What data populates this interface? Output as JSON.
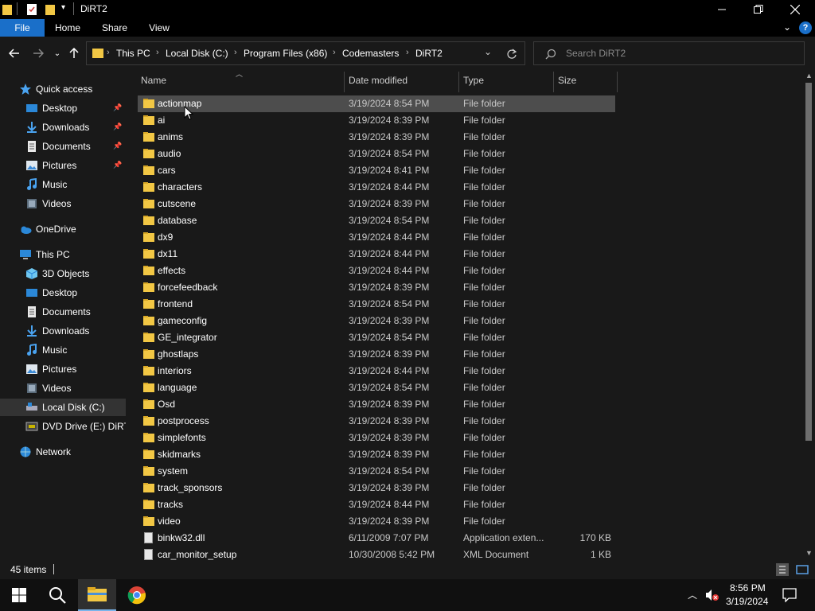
{
  "window": {
    "title": "DiRT2"
  },
  "ribbon": {
    "tabs": [
      "File",
      "Home",
      "Share",
      "View"
    ]
  },
  "address": {
    "crumbs": [
      "This PC",
      "Local Disk (C:)",
      "Program Files (x86)",
      "Codemasters",
      "DiRT2"
    ]
  },
  "search": {
    "placeholder": "Search DiRT2"
  },
  "sidebar": {
    "items": [
      {
        "label": "Quick access",
        "icon": "star-icon"
      },
      {
        "label": "Desktop",
        "icon": "desktop-icon",
        "pinned": true
      },
      {
        "label": "Downloads",
        "icon": "download-icon",
        "pinned": true
      },
      {
        "label": "Documents",
        "icon": "documents-icon",
        "pinned": true
      },
      {
        "label": "Pictures",
        "icon": "pictures-icon",
        "pinned": true
      },
      {
        "label": "Music",
        "icon": "music-icon"
      },
      {
        "label": "Videos",
        "icon": "videos-icon"
      },
      {
        "label": "OneDrive",
        "icon": "cloud-icon"
      },
      {
        "label": "This PC",
        "icon": "computer-icon"
      },
      {
        "label": "3D Objects",
        "icon": "cube-icon"
      },
      {
        "label": "Desktop",
        "icon": "desktop-icon"
      },
      {
        "label": "Documents",
        "icon": "documents-icon"
      },
      {
        "label": "Downloads",
        "icon": "download-icon"
      },
      {
        "label": "Music",
        "icon": "music-icon"
      },
      {
        "label": "Pictures",
        "icon": "pictures-icon"
      },
      {
        "label": "Videos",
        "icon": "videos-icon"
      },
      {
        "label": "Local Disk (C:)",
        "icon": "drive-icon",
        "selected": true
      },
      {
        "label": "DVD Drive (E:) DiRT2",
        "icon": "dvd-icon"
      },
      {
        "label": "Network",
        "icon": "network-icon"
      }
    ]
  },
  "columns": {
    "name": "Name",
    "date": "Date modified",
    "type": "Type",
    "size": "Size"
  },
  "files": [
    {
      "name": "actionmap",
      "date": "3/19/2024 8:54 PM",
      "type": "File folder",
      "size": "",
      "kind": "folder",
      "selected": true
    },
    {
      "name": "ai",
      "date": "3/19/2024 8:39 PM",
      "type": "File folder",
      "size": "",
      "kind": "folder"
    },
    {
      "name": "anims",
      "date": "3/19/2024 8:39 PM",
      "type": "File folder",
      "size": "",
      "kind": "folder"
    },
    {
      "name": "audio",
      "date": "3/19/2024 8:54 PM",
      "type": "File folder",
      "size": "",
      "kind": "folder"
    },
    {
      "name": "cars",
      "date": "3/19/2024 8:41 PM",
      "type": "File folder",
      "size": "",
      "kind": "folder"
    },
    {
      "name": "characters",
      "date": "3/19/2024 8:44 PM",
      "type": "File folder",
      "size": "",
      "kind": "folder"
    },
    {
      "name": "cutscene",
      "date": "3/19/2024 8:39 PM",
      "type": "File folder",
      "size": "",
      "kind": "folder"
    },
    {
      "name": "database",
      "date": "3/19/2024 8:54 PM",
      "type": "File folder",
      "size": "",
      "kind": "folder"
    },
    {
      "name": "dx9",
      "date": "3/19/2024 8:44 PM",
      "type": "File folder",
      "size": "",
      "kind": "folder"
    },
    {
      "name": "dx11",
      "date": "3/19/2024 8:44 PM",
      "type": "File folder",
      "size": "",
      "kind": "folder"
    },
    {
      "name": "effects",
      "date": "3/19/2024 8:44 PM",
      "type": "File folder",
      "size": "",
      "kind": "folder"
    },
    {
      "name": "forcefeedback",
      "date": "3/19/2024 8:39 PM",
      "type": "File folder",
      "size": "",
      "kind": "folder"
    },
    {
      "name": "frontend",
      "date": "3/19/2024 8:54 PM",
      "type": "File folder",
      "size": "",
      "kind": "folder"
    },
    {
      "name": "gameconfig",
      "date": "3/19/2024 8:39 PM",
      "type": "File folder",
      "size": "",
      "kind": "folder"
    },
    {
      "name": "GE_integrator",
      "date": "3/19/2024 8:54 PM",
      "type": "File folder",
      "size": "",
      "kind": "folder"
    },
    {
      "name": "ghostlaps",
      "date": "3/19/2024 8:39 PM",
      "type": "File folder",
      "size": "",
      "kind": "folder"
    },
    {
      "name": "interiors",
      "date": "3/19/2024 8:44 PM",
      "type": "File folder",
      "size": "",
      "kind": "folder"
    },
    {
      "name": "language",
      "date": "3/19/2024 8:54 PM",
      "type": "File folder",
      "size": "",
      "kind": "folder"
    },
    {
      "name": "Osd",
      "date": "3/19/2024 8:39 PM",
      "type": "File folder",
      "size": "",
      "kind": "folder"
    },
    {
      "name": "postprocess",
      "date": "3/19/2024 8:39 PM",
      "type": "File folder",
      "size": "",
      "kind": "folder"
    },
    {
      "name": "simplefonts",
      "date": "3/19/2024 8:39 PM",
      "type": "File folder",
      "size": "",
      "kind": "folder"
    },
    {
      "name": "skidmarks",
      "date": "3/19/2024 8:39 PM",
      "type": "File folder",
      "size": "",
      "kind": "folder"
    },
    {
      "name": "system",
      "date": "3/19/2024 8:54 PM",
      "type": "File folder",
      "size": "",
      "kind": "folder"
    },
    {
      "name": "track_sponsors",
      "date": "3/19/2024 8:39 PM",
      "type": "File folder",
      "size": "",
      "kind": "folder"
    },
    {
      "name": "tracks",
      "date": "3/19/2024 8:44 PM",
      "type": "File folder",
      "size": "",
      "kind": "folder"
    },
    {
      "name": "video",
      "date": "3/19/2024 8:39 PM",
      "type": "File folder",
      "size": "",
      "kind": "folder"
    },
    {
      "name": "binkw32.dll",
      "date": "6/11/2009 7:07 PM",
      "type": "Application exten...",
      "size": "170 KB",
      "kind": "file"
    },
    {
      "name": "car_monitor_setup",
      "date": "10/30/2008 5:42 PM",
      "type": "XML Document",
      "size": "1 KB",
      "kind": "file"
    }
  ],
  "status": {
    "items": "45 items"
  },
  "taskbar": {
    "time": "8:56 PM",
    "date": "3/19/2024"
  },
  "colors": {
    "accent": "#1a6fc9",
    "folder": "#f2c744",
    "selection": "#4d4d4d"
  }
}
